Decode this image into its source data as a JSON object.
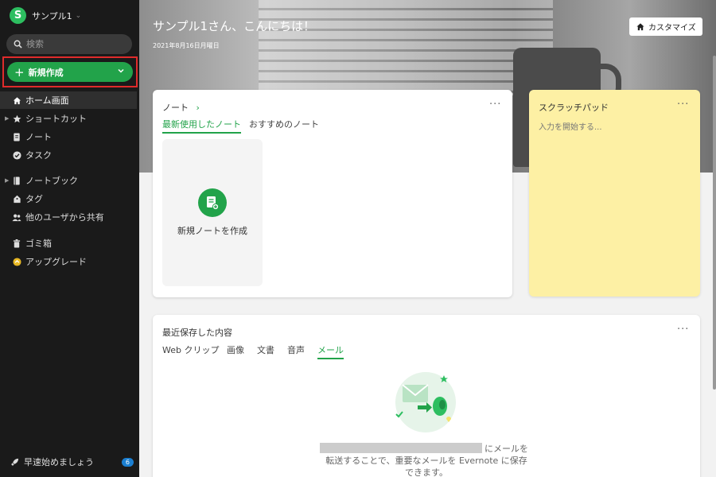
{
  "sidebar": {
    "account_initial": "S",
    "account_name": "サンプル1",
    "search_placeholder": "検索",
    "new_button_label": "新規作成",
    "items": [
      {
        "label": "ホーム画面"
      },
      {
        "label": "ショートカット"
      },
      {
        "label": "ノート"
      },
      {
        "label": "タスク"
      },
      {
        "label": "ノートブック"
      },
      {
        "label": "タグ"
      },
      {
        "label": "他のユーザから共有"
      },
      {
        "label": "ゴミ箱"
      },
      {
        "label": "アップグレード"
      }
    ],
    "footer_label": "早速始めましょう",
    "footer_badge": "6"
  },
  "hero": {
    "greeting": "サンプル1さん、こんにちは！",
    "date": "2021年8月16日月曜日",
    "customize_label": "カスタマイズ"
  },
  "notes_card": {
    "title": "ノート",
    "tabs": [
      "最新使用したノート",
      "おすすめのノート"
    ],
    "active_tab": "最新使用したノート",
    "new_note_label": "新規ノートを作成"
  },
  "scratchpad": {
    "title": "スクラッチパッド",
    "placeholder": "入力を開始する..."
  },
  "recent_card": {
    "title": "最近保存した内容",
    "tabs": [
      "Web クリップ",
      "画像",
      "文書",
      "音声",
      "メール"
    ],
    "active_tab": "メール",
    "message_line1": "にメールを",
    "message_line2": "転送することで、重要なメールを Evernote に保存",
    "message_line3": "できます。"
  },
  "colors": {
    "accent": "#22a34a",
    "sidebar_bg": "#1a1a1a",
    "highlight_border": "#e02b2b",
    "scratch_bg": "#fdf0a4",
    "badge": "#1b7fd1"
  }
}
